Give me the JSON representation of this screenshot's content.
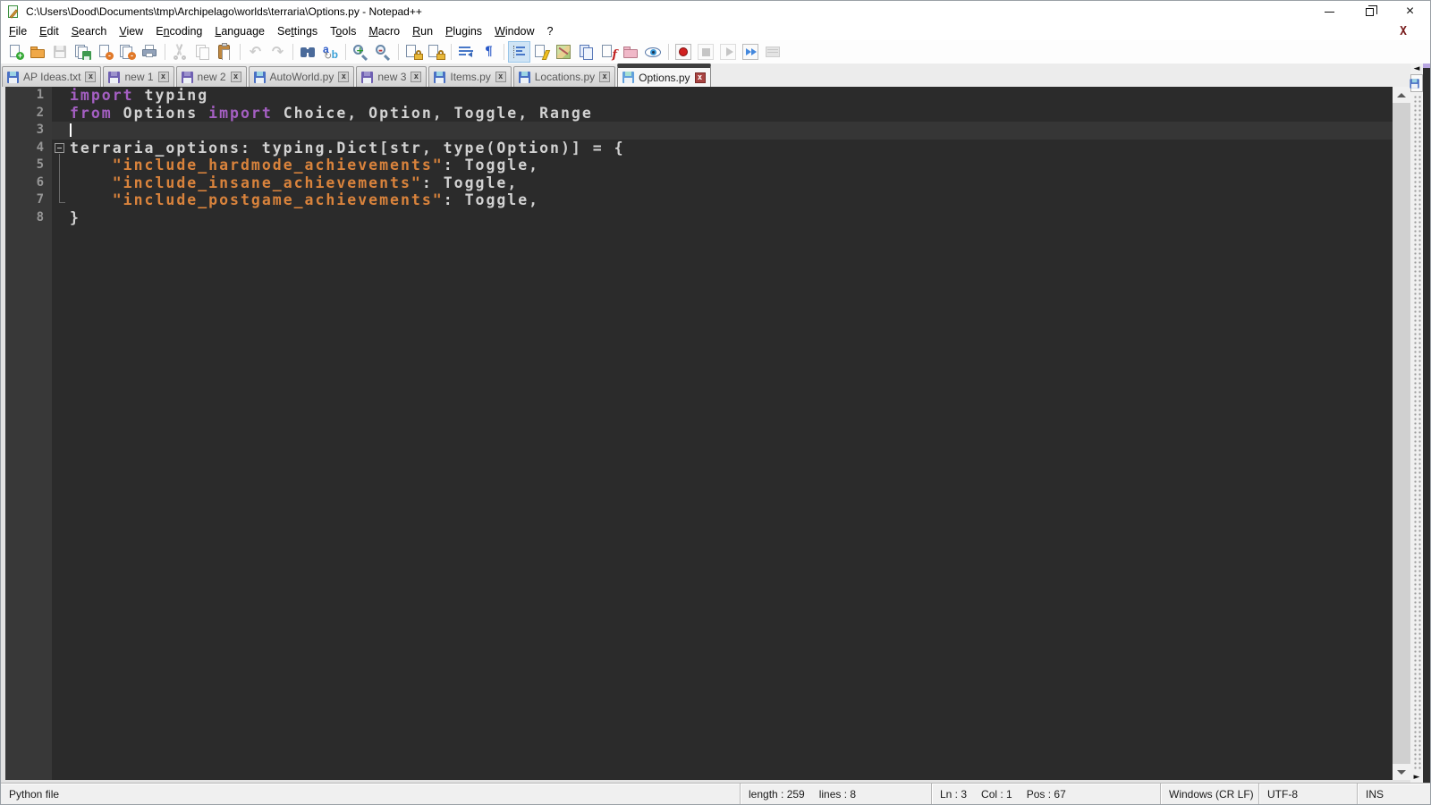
{
  "window": {
    "title": "C:\\Users\\Dood\\Documents\\tmp\\Archipelago\\worlds\\terraria\\Options.py - Notepad++"
  },
  "menu": {
    "items": [
      {
        "label": "File",
        "accel": 0
      },
      {
        "label": "Edit",
        "accel": 0
      },
      {
        "label": "Search",
        "accel": 0
      },
      {
        "label": "View",
        "accel": 0
      },
      {
        "label": "Encoding",
        "accel": 1
      },
      {
        "label": "Language",
        "accel": 0
      },
      {
        "label": "Settings",
        "accel": 2
      },
      {
        "label": "Tools",
        "accel": 1
      },
      {
        "label": "Macro",
        "accel": 0
      },
      {
        "label": "Run",
        "accel": 0
      },
      {
        "label": "Plugins",
        "accel": 0
      },
      {
        "label": "Window",
        "accel": 0
      },
      {
        "label": "?",
        "accel": -1
      }
    ],
    "doc_close_label": "X"
  },
  "toolbar": {
    "groups": [
      [
        {
          "name": "new-file-icon"
        },
        {
          "name": "open-folder-icon"
        },
        {
          "name": "save-icon",
          "disabled": true
        },
        {
          "name": "save-all-icon"
        },
        {
          "name": "close-file-icon"
        },
        {
          "name": "close-all-icon"
        },
        {
          "name": "print-icon"
        }
      ],
      [
        {
          "name": "cut-icon",
          "disabled": true
        },
        {
          "name": "copy-icon",
          "disabled": true
        },
        {
          "name": "paste-icon"
        }
      ],
      [
        {
          "name": "undo-icon",
          "disabled": true
        },
        {
          "name": "redo-icon",
          "disabled": true
        }
      ],
      [
        {
          "name": "find-icon"
        },
        {
          "name": "replace-icon"
        }
      ],
      [
        {
          "name": "zoom-in-icon"
        },
        {
          "name": "zoom-out-icon"
        }
      ],
      [
        {
          "name": "sync-vertical-icon"
        },
        {
          "name": "sync-horizontal-icon"
        }
      ],
      [
        {
          "name": "word-wrap-icon"
        },
        {
          "name": "show-all-characters-icon"
        }
      ],
      [
        {
          "name": "indent-guide-icon",
          "active": true
        },
        {
          "name": "user-defined-language-icon"
        },
        {
          "name": "document-map-icon"
        },
        {
          "name": "document-list-icon"
        },
        {
          "name": "function-list-icon"
        },
        {
          "name": "folder-as-workspace-icon"
        },
        {
          "name": "monitoring-icon"
        }
      ],
      [
        {
          "name": "macro-record-icon"
        },
        {
          "name": "macro-stop-icon",
          "disabled": true
        },
        {
          "name": "macro-play-icon",
          "disabled": true
        },
        {
          "name": "macro-run-multiple-icon"
        },
        {
          "name": "macro-save-icon",
          "disabled": true
        }
      ]
    ]
  },
  "tabs": [
    {
      "label": "AP Ideas.txt",
      "modified": false,
      "active": false
    },
    {
      "label": "new 1",
      "modified": true,
      "active": false
    },
    {
      "label": "new 2",
      "modified": true,
      "active": false
    },
    {
      "label": "AutoWorld.py",
      "modified": false,
      "active": false
    },
    {
      "label": "new 3",
      "modified": true,
      "active": false
    },
    {
      "label": "Items.py",
      "modified": false,
      "active": false
    },
    {
      "label": "Locations.py",
      "modified": false,
      "active": false
    },
    {
      "label": "Options.py",
      "modified": false,
      "active": true
    }
  ],
  "rail": {
    "tab_scroll_left": "◄",
    "panel_collapse_right": "►"
  },
  "editor": {
    "colors": {
      "background": "#2b2b2b",
      "gutter_background": "#383838",
      "current_line": "#363636",
      "keyword": "#a45fc2",
      "string": "#d9833c",
      "text": "#d2d2d2",
      "line_number": "#969696"
    },
    "lines": [
      {
        "num": "1",
        "tokens": [
          {
            "c": "kw",
            "t": "import"
          },
          {
            "c": "tx",
            "t": " typing"
          }
        ]
      },
      {
        "num": "2",
        "tokens": [
          {
            "c": "kw",
            "t": "from"
          },
          {
            "c": "tx",
            "t": " Options "
          },
          {
            "c": "kw",
            "t": "import"
          },
          {
            "c": "tx",
            "t": " Choice, Option, Toggle, Range"
          }
        ]
      },
      {
        "num": "3",
        "current": true,
        "caret": true,
        "tokens": []
      },
      {
        "num": "4",
        "fold": "open",
        "tokens": [
          {
            "c": "tx",
            "t": "terraria_options: typing.Dict[str, type(Option)] = {"
          }
        ]
      },
      {
        "num": "5",
        "fold": "line",
        "tokens": [
          {
            "c": "tx",
            "t": "    "
          },
          {
            "c": "st",
            "t": "\"include_hardmode_achievements\""
          },
          {
            "c": "tx",
            "t": ": Toggle,"
          }
        ]
      },
      {
        "num": "6",
        "fold": "line",
        "tokens": [
          {
            "c": "tx",
            "t": "    "
          },
          {
            "c": "st",
            "t": "\"include_insane_achievements\""
          },
          {
            "c": "tx",
            "t": ": Toggle,"
          }
        ]
      },
      {
        "num": "7",
        "fold": "end",
        "tokens": [
          {
            "c": "tx",
            "t": "    "
          },
          {
            "c": "st",
            "t": "\"include_postgame_achievements\""
          },
          {
            "c": "tx",
            "t": ": Toggle,"
          }
        ]
      },
      {
        "num": "8",
        "tokens": [
          {
            "c": "tx",
            "t": "}"
          }
        ]
      }
    ]
  },
  "status": {
    "doc_type": "Python file",
    "length": "length : 259",
    "lines": "lines : 8",
    "line": "Ln : 3",
    "column": "Col : 1",
    "position": "Pos : 67",
    "eol": "Windows (CR LF)",
    "encoding": "UTF-8",
    "typing_mode": "INS"
  }
}
